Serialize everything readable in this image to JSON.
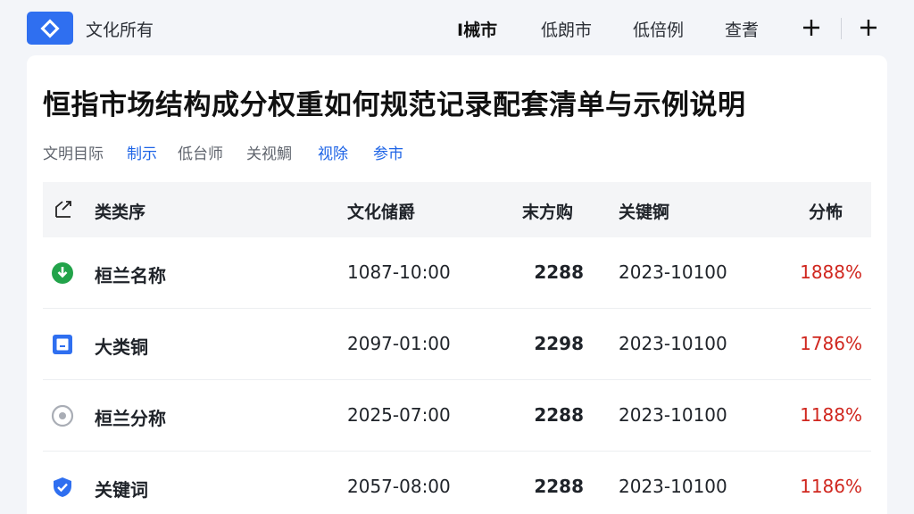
{
  "header": {
    "app_title": "文化所有",
    "nav": [
      {
        "label": "I械市",
        "active": true
      },
      {
        "label": "低朗市",
        "active": false
      },
      {
        "label": "低倍例",
        "active": false
      },
      {
        "label": "查耆",
        "active": false
      }
    ],
    "plus_icon": "plus-icon"
  },
  "page": {
    "title": "恒指市场结构成分权重如何规范记录配套清单与示例说明",
    "filters": [
      {
        "label": "文明目际",
        "color": "#60656e"
      },
      {
        "label": "制示",
        "color": "#1e64e6"
      },
      {
        "label": "低台师",
        "color": "#60656e"
      },
      {
        "label": "关视鯛",
        "color": "#60656e"
      },
      {
        "label": "视除",
        "color": "#1e64e6"
      },
      {
        "label": "参市",
        "color": "#1e64e6"
      }
    ]
  },
  "table": {
    "columns": [
      "类类序",
      "文化储爵",
      "末方购",
      "关键锕",
      "分怖"
    ],
    "rows": [
      {
        "icon": "green-download-circle-icon",
        "name": "桓兰名称",
        "time": "1087-10:00",
        "qty": "2288",
        "date": "2023-10100",
        "pct": "1888%"
      },
      {
        "icon": "blue-square-icon",
        "name": "大类铜",
        "time": "2097-01:00",
        "qty": "2298",
        "date": "2023-10100",
        "pct": "1786%"
      },
      {
        "icon": "gray-ring-icon",
        "name": "桓兰分称",
        "time": "2025-07:00",
        "qty": "2288",
        "date": "2023-10100",
        "pct": "1188%"
      },
      {
        "icon": "blue-shield-check-icon",
        "name": "关键词",
        "time": "2057-08:00",
        "qty": "2288",
        "date": "2023-10100",
        "pct": "1186%"
      }
    ]
  },
  "colors": {
    "brand_blue": "#2f6ff0",
    "link_blue": "#1e64e6",
    "percent_red": "#d0271f",
    "green": "#22a34a"
  }
}
